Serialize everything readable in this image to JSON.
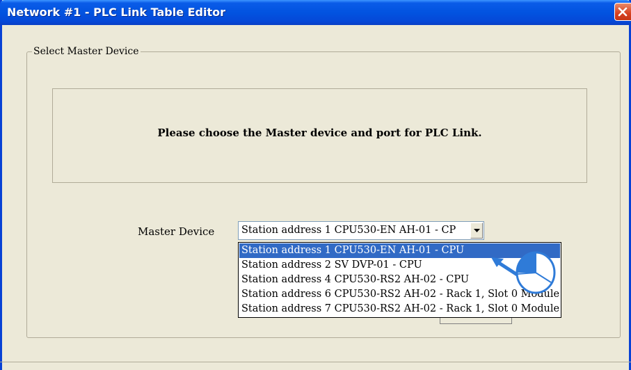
{
  "window": {
    "title": "Network #1 - PLC Link Table Editor"
  },
  "group": {
    "legend": "Select Master Device"
  },
  "info": {
    "message": "Please choose the Master device and port for PLC Link."
  },
  "master_device": {
    "label": "Master Device",
    "selected_value": "Station address 1  CPU530-EN  AH-01 - CP",
    "options": [
      "Station address 1  CPU530-EN  AH-01 - CPU",
      "Station address 2  SV  DVP-01 - CPU",
      "Station address 4  CPU530-RS2  AH-02 - CPU",
      "Station address 6 CPU530-RS2 AH-02 - Rack 1, Slot 0 Module",
      "Station address 7 CPU530-RS2 AH-02 - Rack 1, Slot 0 Module"
    ],
    "selected_index": 0
  },
  "colors": {
    "titlebar": "#0253e0",
    "selection": "#316ac5",
    "pointer": "#2f7bd8",
    "close": "#d7401f"
  },
  "icons": {
    "close": "close-icon",
    "dropdown": "chevron-down-icon",
    "pointer": "mouse-click-icon"
  }
}
